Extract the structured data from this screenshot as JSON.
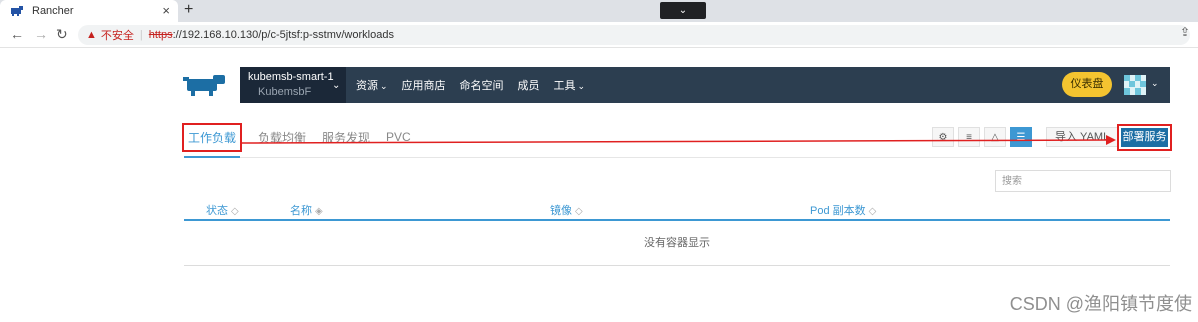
{
  "browser": {
    "tab_title": "Rancher",
    "tab_close": "×",
    "new_tab": "+",
    "dropdown_glyph": "⌄",
    "back": "←",
    "forward": "→",
    "reload": "↻",
    "warning_icon": "▲",
    "insecure_label": "不安全",
    "separator": "|",
    "url_scheme": "https",
    "url_rest": "://192.168.10.130/p/c-5jtsf:p-sstmv/workloads",
    "share_glyph": "⇪"
  },
  "header": {
    "cluster_name": "kubemsb-smart-1",
    "project_name": "KubemsbF",
    "caret": "⌄",
    "menu": [
      {
        "label": "资源",
        "caret": "⌄"
      },
      {
        "label": "应用商店",
        "caret": ""
      },
      {
        "label": "命名空间",
        "caret": ""
      },
      {
        "label": "成员",
        "caret": ""
      },
      {
        "label": "工具",
        "caret": "⌄"
      }
    ],
    "dashboard_label": "仪表盘",
    "avatar_caret": "⌄"
  },
  "subtabs": [
    {
      "label": "工作负载",
      "active": true
    },
    {
      "label": "负载均衡",
      "active": false
    },
    {
      "label": "服务发现",
      "active": false
    },
    {
      "label": "PVC",
      "active": false
    }
  ],
  "toolbar": {
    "icons": [
      "gear-icon",
      "list-icon",
      "alert-icon",
      "tree-icon"
    ],
    "import_label": "导入 YAML",
    "deploy_label": "部署服务"
  },
  "search": {
    "placeholder": "搜索"
  },
  "table": {
    "columns": [
      {
        "label": "状态",
        "sort": "◇"
      },
      {
        "label": "名称",
        "sort": "◈"
      },
      {
        "label": "镜像",
        "sort": "◇"
      },
      {
        "label": "Pod 副本数",
        "sort": "◇"
      }
    ],
    "empty_message": "没有容器显示"
  },
  "watermark": "CSDN @渔阳镇节度使",
  "colors": {
    "header_bg": "#2c3e50",
    "accent": "#3d98d3",
    "annotation_red": "#e02020",
    "dashboard_yellow": "#f4c430",
    "deploy_blue": "#1c6ea4"
  }
}
